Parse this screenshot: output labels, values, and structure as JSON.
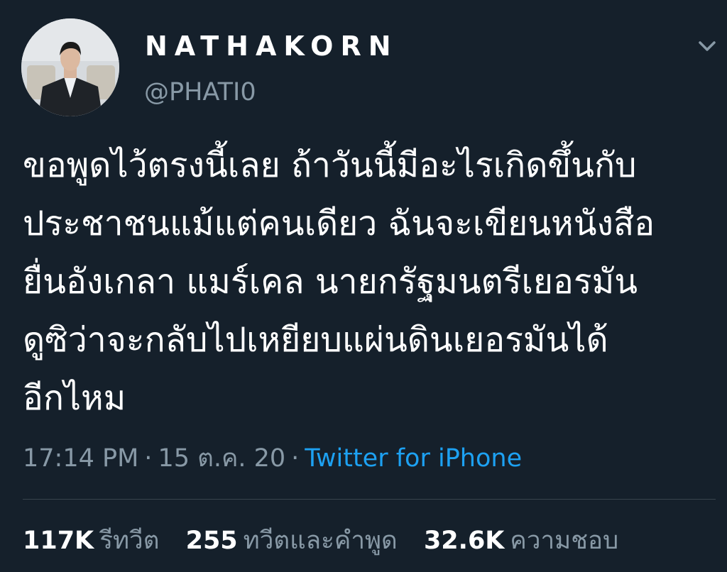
{
  "user": {
    "display_name": "NATHAKORN",
    "handle": "@PHATI0"
  },
  "icons": {
    "menu": "chevron-down-icon",
    "avatar": "profile-photo"
  },
  "tweet": {
    "lines": [
      "ขอพูดไว้ตรงนี้เลย ถ้าวันนี้มีอะไรเกิดขึ้นกับ",
      "ประชาชนแม้แต่คนเดียว ฉันจะเขียนหนังสือ",
      "ยื่นอังเกลา แมร์เคล นายกรัฐมนตรีเยอรมัน",
      "ดูซิว่าจะกลับไปเหยียบแผ่นดินเยอรมันได้",
      "อีกไหม"
    ],
    "time": "17:14 PM",
    "date": "15 ต.ค. 20",
    "separator": "·",
    "source": "Twitter for iPhone"
  },
  "stats": {
    "retweets": {
      "count": "117K",
      "label": "รีทวีต"
    },
    "quotes": {
      "count": "255",
      "label": "ทวีตและคำพูด"
    },
    "likes": {
      "count": "32.6K",
      "label": "ความชอบ"
    }
  },
  "colors": {
    "background": "#15202b",
    "primary_text": "#ffffff",
    "secondary_text": "#8899a6",
    "link": "#1da1f2",
    "divider": "#38444d"
  }
}
